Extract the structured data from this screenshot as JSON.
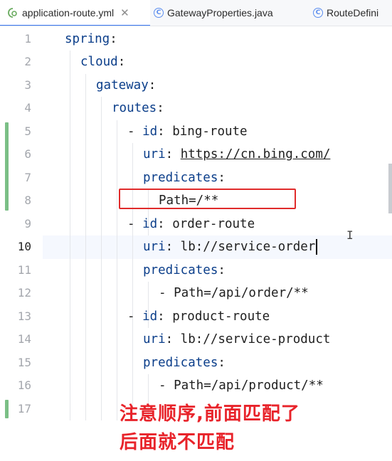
{
  "tabs": [
    {
      "label": "application-route.yml",
      "icon": "yaml-file-icon",
      "active": true,
      "closable": true
    },
    {
      "label": "GatewayProperties.java",
      "icon": "class-icon",
      "active": false
    },
    {
      "label": "RouteDefini",
      "icon": "class-icon",
      "active": false
    }
  ],
  "editor": {
    "current_line": 10,
    "lines": [
      {
        "n": "1",
        "indent": 0,
        "parts": [
          [
            "key",
            "spring"
          ],
          [
            "plain",
            ":"
          ]
        ]
      },
      {
        "n": "2",
        "indent": 1,
        "parts": [
          [
            "key",
            "cloud"
          ],
          [
            "plain",
            ":"
          ]
        ]
      },
      {
        "n": "3",
        "indent": 2,
        "parts": [
          [
            "key",
            "gateway"
          ],
          [
            "plain",
            ":"
          ]
        ]
      },
      {
        "n": "4",
        "indent": 3,
        "parts": [
          [
            "key",
            "routes"
          ],
          [
            "plain",
            ":"
          ]
        ]
      },
      {
        "n": "5",
        "indent": 4,
        "parts": [
          [
            "plain",
            "- "
          ],
          [
            "key",
            "id"
          ],
          [
            "plain",
            ": bing-route"
          ]
        ]
      },
      {
        "n": "6",
        "indent": 5,
        "parts": [
          [
            "key",
            "uri"
          ],
          [
            "plain",
            ": "
          ],
          [
            "url",
            "https://cn.bing.com/"
          ]
        ]
      },
      {
        "n": "7",
        "indent": 5,
        "parts": [
          [
            "key",
            "predicates"
          ],
          [
            "plain",
            ":"
          ]
        ]
      },
      {
        "n": "8",
        "indent": 6,
        "parts": [
          [
            "plain",
            "Path=/**"
          ]
        ]
      },
      {
        "n": "9",
        "indent": 4,
        "parts": [
          [
            "plain",
            "- "
          ],
          [
            "key",
            "id"
          ],
          [
            "plain",
            ": order-route"
          ]
        ]
      },
      {
        "n": "10",
        "indent": 5,
        "parts": [
          [
            "key",
            "uri"
          ],
          [
            "plain",
            ": lb://service-order"
          ]
        ]
      },
      {
        "n": "11",
        "indent": 5,
        "parts": [
          [
            "key",
            "predicates"
          ],
          [
            "plain",
            ":"
          ]
        ]
      },
      {
        "n": "12",
        "indent": 6,
        "parts": [
          [
            "plain",
            "- Path=/api/order/**"
          ]
        ]
      },
      {
        "n": "13",
        "indent": 4,
        "parts": [
          [
            "plain",
            "- "
          ],
          [
            "key",
            "id"
          ],
          [
            "plain",
            ": product-route"
          ]
        ]
      },
      {
        "n": "14",
        "indent": 5,
        "parts": [
          [
            "key",
            "uri"
          ],
          [
            "plain",
            ": lb://service-product"
          ]
        ]
      },
      {
        "n": "15",
        "indent": 5,
        "parts": [
          [
            "key",
            "predicates"
          ],
          [
            "plain",
            ":"
          ]
        ]
      },
      {
        "n": "16",
        "indent": 6,
        "parts": [
          [
            "plain",
            "- Path=/api/product/**"
          ]
        ]
      },
      {
        "n": "17",
        "indent": 0,
        "parts": []
      }
    ]
  },
  "annotation": {
    "line1": "注意顺序,前面匹配了",
    "line2": "后面就不匹配"
  },
  "colors": {
    "key": "#0b3e8a",
    "highlight_box": "#e02b2b",
    "annotation": "#e8232a",
    "vcs_added": "#7bbf86"
  }
}
